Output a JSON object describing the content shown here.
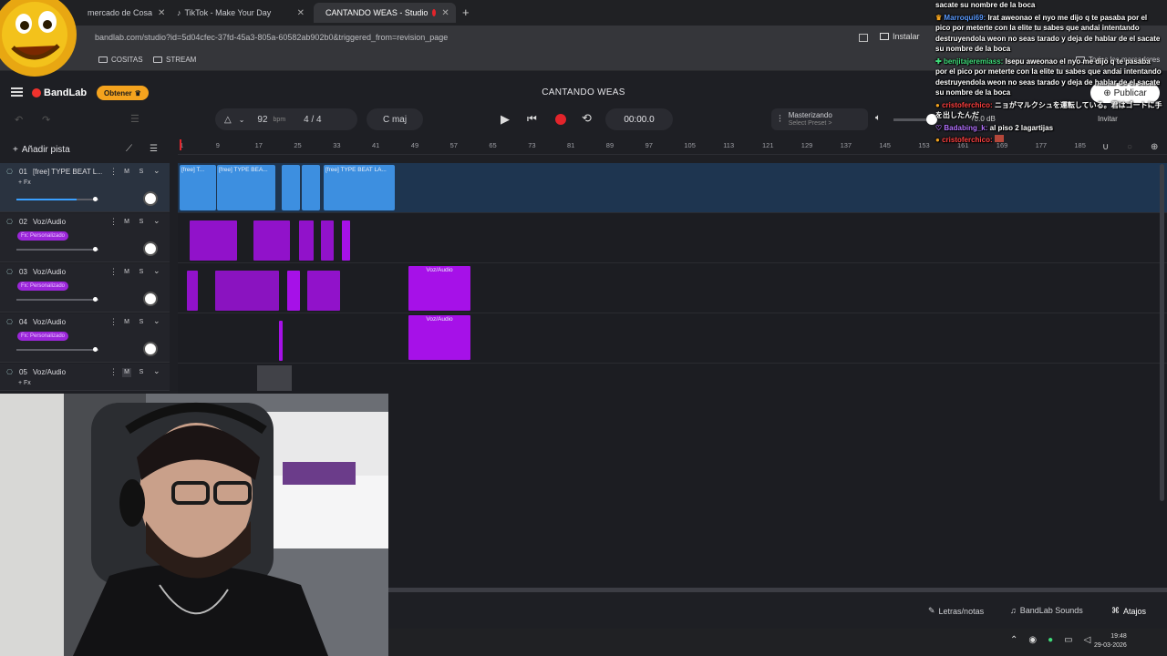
{
  "browser": {
    "tabs": [
      {
        "label": "mercado de Cosa",
        "active": false
      },
      {
        "label": "TikTok - Make Your Day",
        "active": false
      },
      {
        "label": "CANTANDO WEAS - Studio",
        "active": true
      }
    ],
    "new_tab": "+",
    "url": "bandlab.com/studio?id=5d04cfec-37fd-45a3-805a-60582ab902b0&triggered_from=revision_page",
    "install_label": "Instalar",
    "bookmarks": [
      "COSITAS",
      "STREAM"
    ],
    "all_bookmarks": "Todos los marcadores"
  },
  "app": {
    "brand": "BandLab",
    "obtener_label": "Obtener",
    "project_title": "CANTANDO WEAS",
    "publish_label": "Publicar"
  },
  "toolbar": {
    "tempo": "92",
    "tempo_unit": "bpm",
    "time_signature": "4 / 4",
    "key": "C maj",
    "time": "00:00.0",
    "mastering_label": "Masterizando",
    "mastering_preset": "Select Preset >",
    "volume_db": "+0.0 dB",
    "invite_label": "Invitar"
  },
  "tracks_panel": {
    "add_track_label": "Añadir pista"
  },
  "ruler": {
    "ticks": [
      "1",
      "9",
      "17",
      "25",
      "33",
      "41",
      "49",
      "57",
      "65",
      "73",
      "81",
      "89",
      "97",
      "105",
      "113",
      "121",
      "129",
      "137",
      "145",
      "153",
      "161",
      "169",
      "177",
      "185"
    ]
  },
  "tracks": [
    {
      "num": "01",
      "name": "[free] TYPE BEAT L...",
      "fx": "+ Fx",
      "fx_active": false,
      "volume": 0.8,
      "mute": "M",
      "solo": "S"
    },
    {
      "num": "02",
      "name": "Voz/Audio",
      "fx": "Fx: Personalizado",
      "fx_active": true,
      "volume": 0.8,
      "mute": "M",
      "solo": "S"
    },
    {
      "num": "03",
      "name": "Voz/Audio",
      "fx": "Fx: Personalizado",
      "fx_active": true,
      "volume": 0.8,
      "mute": "M",
      "solo": "S"
    },
    {
      "num": "04",
      "name": "Voz/Audio",
      "fx": "Fx: Personalizado",
      "fx_active": true,
      "volume": 0.8,
      "mute": "M",
      "solo": "S"
    },
    {
      "num": "05",
      "name": "Voz/Audio",
      "fx": "+ Fx",
      "fx_active": false,
      "volume": 0.8,
      "mute": "M",
      "solo": "S"
    }
  ],
  "clips": {
    "beat_labels": [
      "[free] T...",
      "[free] TYPE BEA...",
      "[free] TYPE BEAT LA..."
    ],
    "voz_label_1": "Voz/Audio",
    "voz_label_2": "Voz/Audio"
  },
  "bottom": {
    "lyrics_label": "Letras/notas",
    "sounds_label": "BandLab Sounds",
    "shortcuts_label": "Atajos"
  },
  "taskbar": {
    "time": "19:48",
    "date": "29-03-2026"
  },
  "chat": [
    {
      "user": "",
      "text": "sacate su nombre de la boca",
      "color": "white"
    },
    {
      "user": "Marroqui69:",
      "text": "Irat aweonao el nyo me dijo q te pasaba por el pico por meterte con la elite tu sabes que andai intentando destruyendola weon no seas tarado y deja de hablar de el sacate su nombre de la boca",
      "color": "blue"
    },
    {
      "user": "benjitajeremiass:",
      "text": "Isepu aweonao el nyo me dijo q te pasaba por el pico por meterte con la elite tu sabes que andai intentando destruyendola weon no seas tarado y deja de hablar de el sacate su nombre de la boca",
      "color": "green"
    },
    {
      "user": "cristoferchico:",
      "text": "ニョがマルクシュを運転している。君はゴートに手を出したんだ",
      "color": "red"
    },
    {
      "user": "Badabing_k:",
      "text": "al piso 2 lagartijas",
      "color": "purple"
    },
    {
      "user": "cristoferchico:",
      "text": "",
      "color": "red"
    }
  ],
  "colors": {
    "beat_clip": "#3d8fe0",
    "vocal_clip": "#a611e8",
    "record": "#e3242b",
    "obtener": "#f4a31e"
  }
}
